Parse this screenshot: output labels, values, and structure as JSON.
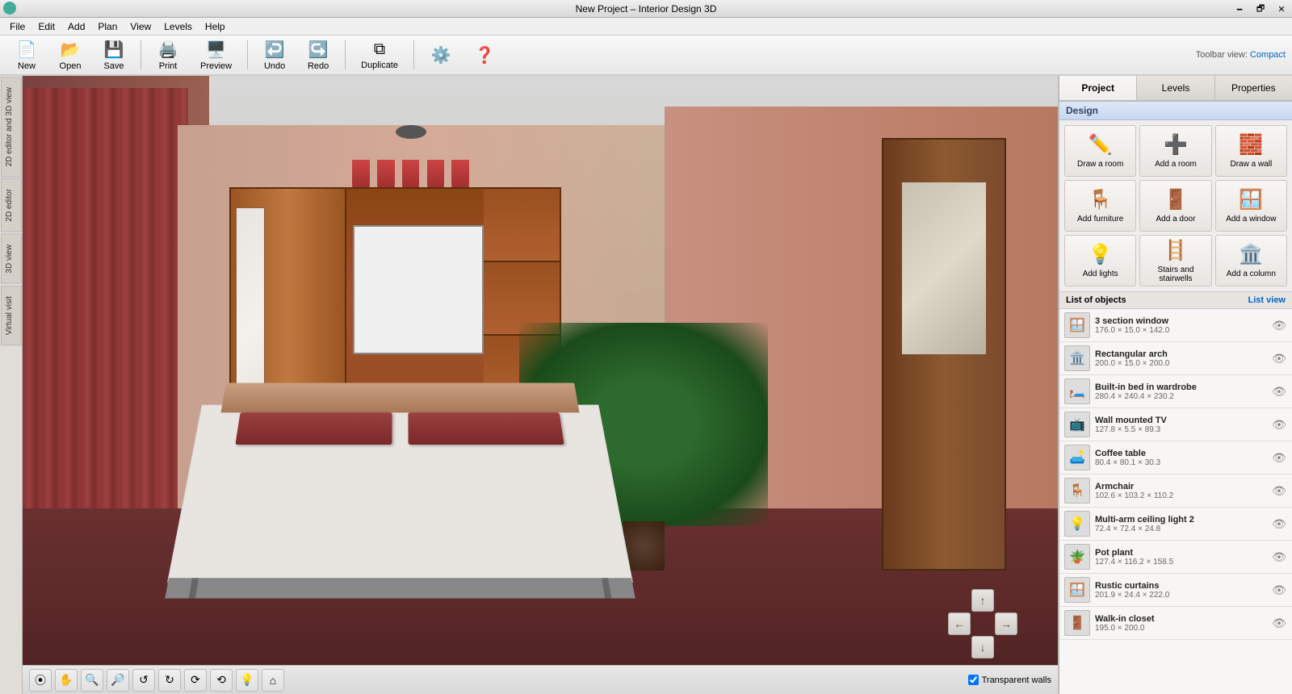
{
  "titlebar": {
    "title": "New Project – Interior Design 3D",
    "min_label": "🗕",
    "max_label": "🗗",
    "close_label": "✕"
  },
  "menubar": {
    "items": [
      "File",
      "Edit",
      "Add",
      "Plan",
      "View",
      "Levels",
      "Help"
    ]
  },
  "toolbar": {
    "new_label": "New",
    "open_label": "Open",
    "save_label": "Save",
    "print_label": "Print",
    "preview_label": "Preview",
    "undo_label": "Undo",
    "redo_label": "Redo",
    "duplicate_label": "Duplicate",
    "settings_label": "⚙",
    "help_label": "?",
    "toolbar_view_prefix": "Toolbar view:",
    "toolbar_view_link": "Compact"
  },
  "left_panel": {
    "tabs": [
      "2D editor and 3D view",
      "2D editor",
      "3D view",
      "Virtual visit"
    ]
  },
  "right_panel": {
    "tabs": [
      "Project",
      "Levels",
      "Properties"
    ],
    "active_tab": "Project",
    "design_section": "Design",
    "design_buttons": [
      {
        "label": "Draw a room",
        "icon": "✏️"
      },
      {
        "label": "Add a room",
        "icon": "➕"
      },
      {
        "label": "Draw a wall",
        "icon": "🧱"
      },
      {
        "label": "Add furniture",
        "icon": "🪑"
      },
      {
        "label": "Add a door",
        "icon": "🚪"
      },
      {
        "label": "Add a window",
        "icon": "🪟"
      },
      {
        "label": "Add lights",
        "icon": "💡"
      },
      {
        "label": "Stairs and stairwells",
        "icon": "🪜"
      },
      {
        "label": "Add a column",
        "icon": "🏛️"
      }
    ],
    "list_header": "List of objects",
    "list_view_label": "List view",
    "objects": [
      {
        "name": "3 section window",
        "dims": "176.0 × 15.0 × 142.0",
        "icon": "🪟"
      },
      {
        "name": "Rectangular arch",
        "dims": "200.0 × 15.0 × 200.0",
        "icon": "🏛️"
      },
      {
        "name": "Built-in bed in wardrobe",
        "dims": "280.4 × 240.4 × 230.2",
        "icon": "🛏️"
      },
      {
        "name": "Wall mounted TV",
        "dims": "127.8 × 5.5 × 89.3",
        "icon": "📺"
      },
      {
        "name": "Coffee table",
        "dims": "80.4 × 80.1 × 30.3",
        "icon": "🛋️"
      },
      {
        "name": "Armchair",
        "dims": "102.6 × 103.2 × 110.2",
        "icon": "🪑"
      },
      {
        "name": "Multi-arm ceiling light 2",
        "dims": "72.4 × 72.4 × 24.8",
        "icon": "💡"
      },
      {
        "name": "Pot plant",
        "dims": "127.4 × 116.2 × 158.5",
        "icon": "🪴"
      },
      {
        "name": "Rustic curtains",
        "dims": "201.9 × 24.4 × 222.0",
        "icon": "🪟"
      },
      {
        "name": "Walk-in closet",
        "dims": "195.0 × 200.0",
        "icon": "🚪"
      }
    ]
  },
  "bottom_bar": {
    "transparent_walls_label": "Transparent walls",
    "nav": {
      "up": "↑",
      "down": "↓",
      "left": "←",
      "right": "→"
    }
  },
  "icons": {
    "rotate_left": "↺",
    "rotate_right": "↻",
    "zoom_in": "🔍",
    "zoom_out": "🔍",
    "pan": "✋",
    "reset": "⌂",
    "vr": "⦿",
    "light_toggle": "💡"
  }
}
